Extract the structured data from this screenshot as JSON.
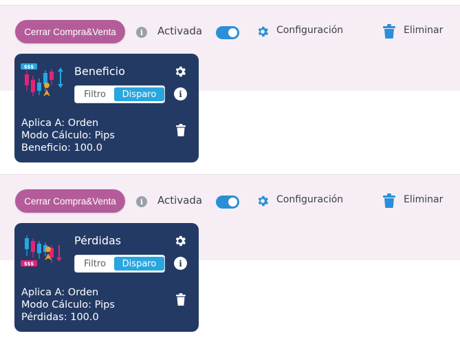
{
  "panels": [
    {
      "button_label": "Cerrar Compra&Venta",
      "status_label": "Activada",
      "toggle_on": true,
      "config_label": "Configuración",
      "delete_label": "Eliminar",
      "card": {
        "title": "Beneficio",
        "badge": "$$$",
        "filter_tab": "Filtro",
        "trigger_tab": "Disparo",
        "active_tab": "Disparo",
        "line1": "Aplica A: Orden",
        "line2": "Modo Cálculo: Pips",
        "line3": "Beneficio: 100.0"
      }
    },
    {
      "button_label": "Cerrar Compra&Venta",
      "status_label": "Activada",
      "toggle_on": true,
      "config_label": "Configuración",
      "delete_label": "Eliminar",
      "card": {
        "title": "Pérdidas",
        "badge": "$$$",
        "filter_tab": "Filtro",
        "trigger_tab": "Disparo",
        "active_tab": "Disparo",
        "line1": "Aplica A: Orden",
        "line2": "Modo Cálculo: Pips",
        "line3": "Pérdidas: 100.0"
      }
    }
  ],
  "colors": {
    "accent_button": "#b45c9a",
    "toggle": "#2b8fd6",
    "card_bg": "#233a64",
    "active_tab": "#29a6e0",
    "band": "#f6eef4"
  },
  "icons": {
    "info": "info-circle-icon",
    "config": "gear-icon",
    "delete": "trash-icon",
    "card_chart": "candlestick-chart-icon"
  }
}
